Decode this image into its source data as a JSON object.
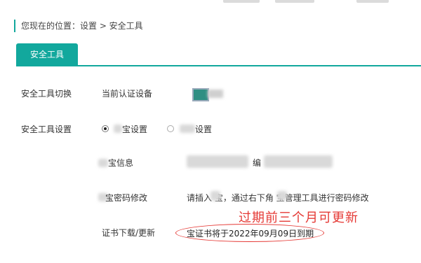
{
  "breadcrumb": {
    "text": "您现在的位置：设置 > 安全工具"
  },
  "tabs": [
    {
      "label": "安全工具"
    }
  ],
  "rows": {
    "switch": {
      "label": "安全工具切换",
      "field": "当前认证设备"
    },
    "settings": {
      "label": "安全工具设置",
      "option1": "宝设置",
      "option2": "设置"
    },
    "info": {
      "label": "宝信息",
      "value_fragment": "编"
    },
    "password": {
      "label": "宝密码修改",
      "value": "请插入   宝，通过右下角   宝管理工具进行密码修改"
    },
    "cert": {
      "label": "证书下载/更新",
      "value": "宝证书将于2022年09月09日到期"
    }
  },
  "annotation": {
    "text": "过期前三个月可更新",
    "color": "#e53935"
  },
  "colors": {
    "accent": "#12a89d"
  }
}
